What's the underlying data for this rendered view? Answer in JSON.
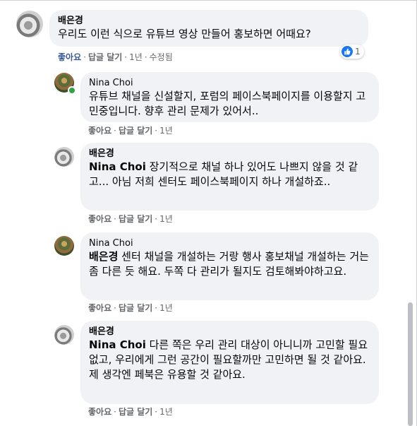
{
  "comments": [
    {
      "author": "배은경",
      "mention": "",
      "text": "우리도 이런 식으로 유튜브 영상 만들어 홍보하면 어때요?",
      "like": "좋아요",
      "reply": "답글 달기",
      "time": "1년",
      "edited": "수정됨",
      "reaction_count": "1"
    },
    {
      "author": "Nina Choi",
      "mention": "",
      "text": "유튜브 채널을 신설할지, 포럼의 페이스북페이지를 이용할지 고민중입니다. 향후 관리 문제가 있어서..",
      "like": "좋아요",
      "reply": "답글 달기",
      "time": "1년"
    },
    {
      "author": "배은경",
      "mention": "Nina Choi",
      "text": " 장기적으로 채널 하나 있어도 나쁘지 않을 것 같고... 아님 저희 센터도 페이스북페이지 하나 개설하죠..",
      "like": "좋아요",
      "reply": "답글 달기",
      "time": "1년"
    },
    {
      "author": "Nina Choi",
      "mention": "배은경",
      "text": " 센터 채널을 개설하는 거랑 행사 홍보채널 개설하는 거는 좀 다른 듯 해요. 두쪽 다 관리가 될지도 검토해봐야하고요.",
      "like": "좋아요",
      "reply": "답글 달기",
      "time": "1년"
    },
    {
      "author": "배은경",
      "mention": "Nina Choi",
      "text": " 다른 쪽은 우리 관리 대상이 아니니까 고민할 필요 없고, 우리에게 그런 공간이 필요할까만 고민하면 될 것 같아요. 제 생각엔 페북은 유용할 것 같아요.",
      "like": "좋아요",
      "reply": "답글 달기",
      "time": "1년"
    }
  ],
  "colors": {
    "bubble": "#f0f2f5",
    "meta": "#65676b",
    "like_blue": "#1877f2",
    "online": "#31a24c"
  }
}
